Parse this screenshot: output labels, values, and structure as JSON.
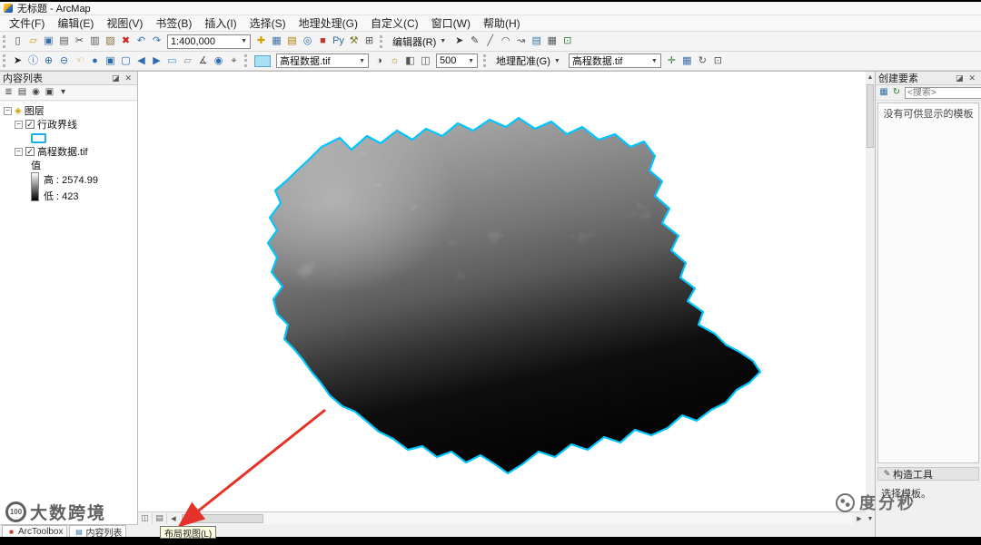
{
  "colors": {
    "boundary": "#00c5ff",
    "arrow": "#e53228",
    "accent_blue": "#2b6cb0"
  },
  "titlebar": {
    "title": "无标题 - ArcMap"
  },
  "menu": {
    "items": [
      {
        "name": "menu-file",
        "label": "文件(F)"
      },
      {
        "name": "menu-edit",
        "label": "编辑(E)"
      },
      {
        "name": "menu-view",
        "label": "视图(V)"
      },
      {
        "name": "menu-bookmarks",
        "label": "书签(B)"
      },
      {
        "name": "menu-insert",
        "label": "插入(I)"
      },
      {
        "name": "menu-selection",
        "label": "选择(S)"
      },
      {
        "name": "menu-geoprocessing",
        "label": "地理处理(G)"
      },
      {
        "name": "menu-customize",
        "label": "自定义(C)"
      },
      {
        "name": "menu-window",
        "label": "窗口(W)"
      },
      {
        "name": "menu-help",
        "label": "帮助(H)"
      }
    ]
  },
  "toolbar_standard": {
    "left_icons": [
      {
        "n": "new-document-icon",
        "g": "▯",
        "c": "#444444"
      },
      {
        "n": "open-folder-icon",
        "g": "▱",
        "c": "#d09a00"
      },
      {
        "n": "save-icon",
        "g": "▣",
        "c": "#3a6ea5"
      },
      {
        "n": "print-icon",
        "g": "▤",
        "c": "#555555"
      },
      {
        "n": "cut-icon",
        "g": "✂",
        "c": "#444444"
      },
      {
        "n": "copy-icon",
        "g": "▥",
        "c": "#555555"
      },
      {
        "n": "paste-icon",
        "g": "▨",
        "c": "#8a6d3b"
      },
      {
        "n": "delete-icon",
        "g": "✖",
        "c": "#cc2222"
      },
      {
        "n": "undo-icon",
        "g": "↶",
        "c": "#2b6cb0"
      },
      {
        "n": "redo-icon",
        "g": "↷",
        "c": "#2b6cb0"
      }
    ],
    "scale_value": "1:400,000",
    "mid_icons": [
      {
        "n": "add-data-icon",
        "g": "✚",
        "c": "#caa400"
      },
      {
        "n": "table-options-icon",
        "g": "▦",
        "c": "#3a6ea5"
      },
      {
        "n": "catalog-icon",
        "g": "▤",
        "c": "#b07c00"
      },
      {
        "n": "search-icon",
        "g": "◎",
        "c": "#2b6cb0"
      },
      {
        "n": "arctoolbox-icon",
        "g": "■",
        "c": "#c0392b"
      },
      {
        "n": "python-icon",
        "g": "Py",
        "c": "#2e6da4"
      },
      {
        "n": "modelbuilder-icon",
        "g": "⚒",
        "c": "#7a7a2a"
      },
      {
        "n": "snapping-icon",
        "g": "⊞",
        "c": "#555555"
      }
    ],
    "editor_label": "编辑器(R)",
    "editor_icons": [
      {
        "n": "edit-tool-icon",
        "g": "➤",
        "c": "#333333"
      },
      {
        "n": "sketch-tool-icon",
        "g": "✎",
        "c": "#444444"
      },
      {
        "n": "straight-segment-icon",
        "g": "╱",
        "c": "#555555"
      },
      {
        "n": "arc-segment-icon",
        "g": "◠",
        "c": "#555555"
      },
      {
        "n": "trace-tool-icon",
        "g": "↝",
        "c": "#555555"
      },
      {
        "n": "attributes-icon",
        "g": "▤",
        "c": "#3a6ea5"
      },
      {
        "n": "sketch-properties-icon",
        "g": "▦",
        "c": "#555555"
      },
      {
        "n": "create-features-icon",
        "g": "⊡",
        "c": "#2e7d32"
      }
    ]
  },
  "toolbar_tools": {
    "left_icons": [
      {
        "n": "select-elements-icon",
        "g": "➤",
        "c": "#222222"
      },
      {
        "n": "identify-icon",
        "g": "ⓘ",
        "c": "#2b6cb0"
      },
      {
        "n": "zoom-in-icon",
        "g": "⊕",
        "c": "#2b6cb0"
      },
      {
        "n": "zoom-out-icon",
        "g": "⊖",
        "c": "#2b6cb0"
      },
      {
        "n": "pan-icon",
        "g": "☜",
        "c": "#c09a5a"
      },
      {
        "n": "full-extent-icon",
        "g": "●",
        "c": "#2b6cb0"
      },
      {
        "n": "fixed-zoom-in-icon",
        "g": "▣",
        "c": "#2b6cb0"
      },
      {
        "n": "fixed-zoom-out-icon",
        "g": "▢",
        "c": "#2b6cb0"
      },
      {
        "n": "previous-extent-icon",
        "g": "◀",
        "c": "#2b6cb0"
      },
      {
        "n": "next-extent-icon",
        "g": "▶",
        "c": "#2b6cb0"
      },
      {
        "n": "select-features-icon",
        "g": "▭",
        "c": "#3aa0d8"
      },
      {
        "n": "clear-selection-icon",
        "g": "▱",
        "c": "#888888"
      },
      {
        "n": "measure-icon",
        "g": "∡",
        "c": "#555555"
      },
      {
        "n": "find-icon",
        "g": "◉",
        "c": "#2b6cb0"
      },
      {
        "n": "go-to-xy-icon",
        "g": "⌖",
        "c": "#555555"
      }
    ],
    "effects_layer": "高程数据.tif",
    "effects_icons": [
      {
        "n": "contrast-icon",
        "g": "◑",
        "c": "#444444"
      },
      {
        "n": "brightness-icon",
        "g": "☼",
        "c": "#b8860b"
      },
      {
        "n": "transparency-icon",
        "g": "◧",
        "c": "#555555"
      },
      {
        "n": "swipe-icon",
        "g": "◫",
        "c": "#555555"
      }
    ],
    "flicker_rate": "500",
    "georef_label": "地理配准(G)",
    "georef_layer": "高程数据.tif",
    "georef_icons": [
      {
        "n": "add-control-points-icon",
        "g": "✛",
        "c": "#2e7d32"
      },
      {
        "n": "link-table-icon",
        "g": "▦",
        "c": "#3a6ea5"
      },
      {
        "n": "rotate-icon",
        "g": "↻",
        "c": "#555555"
      },
      {
        "n": "update-georeferencing-icon",
        "g": "⊡",
        "c": "#555555"
      }
    ]
  },
  "toc": {
    "title": "内容列表",
    "toolbar_icons": [
      {
        "n": "list-by-drawing-order-icon",
        "g": "≣",
        "c": "#444444"
      },
      {
        "n": "list-by-source-icon",
        "g": "▤",
        "c": "#444444"
      },
      {
        "n": "list-by-visibility-icon",
        "g": "◉",
        "c": "#444444"
      },
      {
        "n": "list-by-selection-icon",
        "g": "▣",
        "c": "#444444"
      },
      {
        "n": "toc-options-icon",
        "g": "▾",
        "c": "#444444"
      }
    ],
    "layers_root": "图层",
    "layer_boundary": "行政界线",
    "layer_dem": "高程数据.tif",
    "value_label": "值",
    "high_label": "高 : 2574.99",
    "low_label": "低 : 423"
  },
  "create_features": {
    "title": "创建要素",
    "toolbar_icons": [
      {
        "n": "organize-templates-icon",
        "g": "▦",
        "c": "#3a6ea5"
      },
      {
        "n": "refresh-templates-icon",
        "g": "↻",
        "c": "#2e7d32"
      }
    ],
    "search_placeholder": "<搜索>",
    "empty_text": "没有可供显示的模板",
    "construction_title": "构造工具",
    "construction_hint": "选择模板。"
  },
  "bottom": {
    "tabs": [
      {
        "name": "tab-arctoolbox",
        "label": "ArcToolbox",
        "g": "■",
        "c": "#c0392b"
      },
      {
        "name": "tab-contents",
        "label": "内容列表",
        "g": "▤",
        "c": "#3a6ea5"
      }
    ],
    "tooltip": "布局视图(L)"
  },
  "legend": {
    "dem_high": 2574.99,
    "dem_low": 423
  },
  "watermarks": {
    "left": "大数跨境",
    "right": "度分秒",
    "left_logo": "100"
  }
}
